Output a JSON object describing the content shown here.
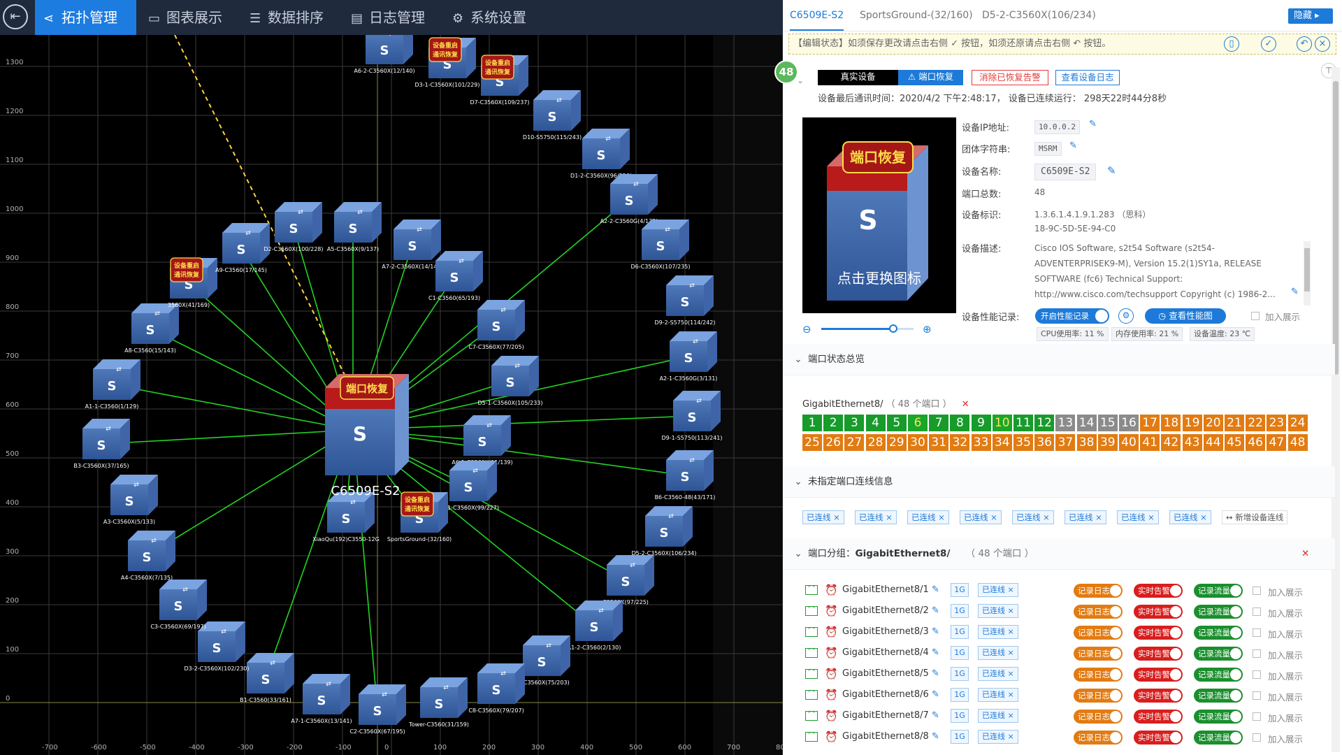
{
  "nav": {
    "items": [
      {
        "label": "拓扑管理",
        "icon": "share-icon",
        "active": true
      },
      {
        "label": "图表展示",
        "icon": "chart-icon",
        "active": false
      },
      {
        "label": "数据排序",
        "icon": "list-icon",
        "active": false
      },
      {
        "label": "日志管理",
        "icon": "log-icon",
        "active": false
      },
      {
        "label": "系统设置",
        "icon": "gear-icon",
        "active": false
      }
    ]
  },
  "topology": {
    "y_ticks": [
      "1300",
      "1200",
      "1100",
      "1000",
      "900",
      "800",
      "700",
      "600",
      "500",
      "400",
      "300",
      "200",
      "100",
      "0"
    ],
    "x_ticks": [
      "-700",
      "-600",
      "-500",
      "-400",
      "-300",
      "-200",
      "-100",
      "0",
      "100",
      "200",
      "300",
      "400",
      "500",
      "600",
      "700",
      "80"
    ],
    "core": {
      "name": "C6509E-S2",
      "badge": "端口恢复",
      "glyph": "S"
    },
    "badge_restart": [
      "设备重启",
      "通讯恢复"
    ],
    "nodes": [
      "A6-2-C3560X(12/140)",
      "D3-1-C3560X(101/229)",
      "D7-C3560X(109/237)",
      "D10-S5750(115/243)",
      "D1-2-C3560X(96/226)",
      "A2-2-C3560G(4/132)",
      "D6-C3560X(107/235)",
      "D9-2-S5750(114/242)",
      "A2-1-C3560G(3/131)",
      "D9-1-S5750(113/241)",
      "B6-C3560-48(43/171)",
      "D5-2-C3560X(106/234)",
      "C3560X(97/225)",
      "A1-2-C3560(2/130)",
      "C6-C3560X(75/203)",
      "C8-C3560X(79/207)",
      "Tower-C3560(31/159)",
      "C2-C3560X(67/195)",
      "A7-1-C3560X(13/141)",
      "B1-C3560(33/161)",
      "D3-2-C3560X(102/230)",
      "C3-C3560X(69/197)",
      "A4-C3560X(7/135)",
      "A3-C3560X(5/133)",
      "B3-C3560X(37/165)",
      "A1-1-C3560(1/129)",
      "A8-C3560(15/143)",
      "3560X(41/169)",
      "A9-C3560(17/145)",
      "D2-C3560X(100/228)",
      "A5-C3560X(9/137)",
      "A7-2-C3560X(14/142)",
      "C1-C3560(65/193)",
      "C7-C3560X(77/205)",
      "D5-1-C3560X(105/233)",
      "A6-1-C3560X(11/139)",
      "D2-1-C3560X(99/227)",
      "SportsGround-(32/160)",
      "XiaoQu(192)C3550-12G"
    ]
  },
  "panel": {
    "tabs": [
      "C6509E-S2",
      "SportsGround-(32/160)",
      "D5-2-C3560X(106/234)"
    ],
    "hide_label": "隐藏",
    "edit_notice": "【编辑状态】如须保存更改请点击右侧 ✓ 按钮，如须还原请点击右侧 ↶ 按钮。",
    "count_badge": "48",
    "buttons": {
      "real_device": "真实设备",
      "port_recover": "⚠ 端口恢复",
      "clear_alarm": "消除已恢复告警",
      "view_log": "查看设备日志"
    },
    "last_comm": "设备最后通讯时间：2020/4/2 下午2:48:17，  设备已连续运行：  298天22时44分8秒",
    "preview": {
      "badge": "端口恢复",
      "glyph": "S",
      "caption": "点击更换图标"
    },
    "info": {
      "ip_label": "设备IP地址:",
      "ip_value": "10.0.0.2",
      "community_label": "团体字符串:",
      "community_value": "MSRM",
      "name_label": "设备名称:",
      "name_value": "C6509E-S2",
      "ports_label": "端口总数:",
      "ports_value": "48",
      "id_label": "设备标识:",
      "id_value1": "1.3.6.1.4.1.9.1.283 （思科）",
      "id_value2": "18-9C-5D-5E-94-C0",
      "desc_label": "设备描述:",
      "desc_lines": [
        "Cisco IOS Software, s2t54 Software (s2t54-",
        "ADVENTERPRISEK9-M), Version 15.2(1)SY1a, RELEASE",
        "SOFTWARE (fc6) Technical Support:",
        "http://www.cisco.com/techsupport Copyright (c) 1986-2..."
      ],
      "perf_label": "设备性能记录:",
      "perf_toggle": "开启性能记录",
      "perf_view": "查看性能图",
      "perf_add": "加入展示",
      "cpu": "CPU使用率: 11 %",
      "mem": "内存使用率: 21 %",
      "temp": "设备温度: 23 ℃"
    },
    "zoom_fraction": 0.78,
    "port_status_title": "端口状态总览",
    "port_group_name": "GigabitEthernet8/",
    "port_group_count": "（ 48 个端口 ）",
    "ports": [
      {
        "n": "1",
        "s": "green"
      },
      {
        "n": "2",
        "s": "green"
      },
      {
        "n": "3",
        "s": "green"
      },
      {
        "n": "4",
        "s": "green"
      },
      {
        "n": "5",
        "s": "green"
      },
      {
        "n": "6",
        "s": "lgreen"
      },
      {
        "n": "7",
        "s": "green"
      },
      {
        "n": "8",
        "s": "green"
      },
      {
        "n": "9",
        "s": "green"
      },
      {
        "n": "10",
        "s": "lgreen"
      },
      {
        "n": "11",
        "s": "green"
      },
      {
        "n": "12",
        "s": "green"
      },
      {
        "n": "13",
        "s": "gray"
      },
      {
        "n": "14",
        "s": "gray"
      },
      {
        "n": "15",
        "s": "gray"
      },
      {
        "n": "16",
        "s": "gray"
      },
      {
        "n": "17",
        "s": "orange"
      },
      {
        "n": "18",
        "s": "orange"
      },
      {
        "n": "19",
        "s": "orange"
      },
      {
        "n": "20",
        "s": "orange"
      },
      {
        "n": "21",
        "s": "orange"
      },
      {
        "n": "22",
        "s": "orange"
      },
      {
        "n": "23",
        "s": "orange"
      },
      {
        "n": "24",
        "s": "orange"
      },
      {
        "n": "25",
        "s": "orange"
      },
      {
        "n": "26",
        "s": "orange"
      },
      {
        "n": "27",
        "s": "orange"
      },
      {
        "n": "28",
        "s": "orange"
      },
      {
        "n": "29",
        "s": "orange"
      },
      {
        "n": "30",
        "s": "orange"
      },
      {
        "n": "31",
        "s": "orange"
      },
      {
        "n": "32",
        "s": "orange"
      },
      {
        "n": "33",
        "s": "orange"
      },
      {
        "n": "34",
        "s": "orange"
      },
      {
        "n": "35",
        "s": "orange"
      },
      {
        "n": "36",
        "s": "orange"
      },
      {
        "n": "37",
        "s": "orange"
      },
      {
        "n": "38",
        "s": "orange"
      },
      {
        "n": "39",
        "s": "orange"
      },
      {
        "n": "40",
        "s": "orange"
      },
      {
        "n": "41",
        "s": "orange"
      },
      {
        "n": "42",
        "s": "orange"
      },
      {
        "n": "43",
        "s": "orange"
      },
      {
        "n": "44",
        "s": "orange"
      },
      {
        "n": "45",
        "s": "orange"
      },
      {
        "n": "46",
        "s": "orange"
      },
      {
        "n": "47",
        "s": "orange"
      },
      {
        "n": "48",
        "s": "orange"
      }
    ],
    "unassigned_title": "未指定端口连线信息",
    "link_tag": "已连线 ×",
    "new_link": "↔ 新增设备连线",
    "port_group_title": "端口分组：",
    "rows": [
      {
        "name": "GigabitEthernet8/1",
        "speed": "1G",
        "link": "已连线 ×",
        "log": "记录日志",
        "alarm": "实时告警",
        "flow": "记录流量",
        "add": "加入展示"
      },
      {
        "name": "GigabitEthernet8/2",
        "speed": "1G",
        "link": "已连线 ×",
        "log": "记录日志",
        "alarm": "实时告警",
        "flow": "记录流量",
        "add": "加入展示"
      },
      {
        "name": "GigabitEthernet8/3",
        "speed": "1G",
        "link": "已连线 ×",
        "log": "记录日志",
        "alarm": "实时告警",
        "flow": "记录流量",
        "add": "加入展示"
      },
      {
        "name": "GigabitEthernet8/4",
        "speed": "1G",
        "link": "已连线 ×",
        "log": "记录日志",
        "alarm": "实时告警",
        "flow": "记录流量",
        "add": "加入展示"
      },
      {
        "name": "GigabitEthernet8/5",
        "speed": "1G",
        "link": "已连线 ×",
        "log": "记录日志",
        "alarm": "实时告警",
        "flow": "记录流量",
        "add": "加入展示"
      },
      {
        "name": "GigabitEthernet8/6",
        "speed": "1G",
        "link": "已连线 ×",
        "log": "记录日志",
        "alarm": "实时告警",
        "flow": "记录流量",
        "add": "加入展示"
      },
      {
        "name": "GigabitEthernet8/7",
        "speed": "1G",
        "link": "已连线 ×",
        "log": "记录日志",
        "alarm": "实时告警",
        "flow": "记录流量",
        "add": "加入展示"
      },
      {
        "name": "GigabitEthernet8/8",
        "speed": "1G",
        "link": "已连线 ×",
        "log": "记录日志",
        "alarm": "实时告警",
        "flow": "记录流量",
        "add": "加入展示"
      }
    ]
  },
  "colors": {
    "accent": "#1d7ad8",
    "link_line": "#22d322",
    "port_green": "#179b2b",
    "port_orange": "#e27b12",
    "port_gray": "#8b8b8b",
    "alarm_red": "#d81e1e"
  }
}
